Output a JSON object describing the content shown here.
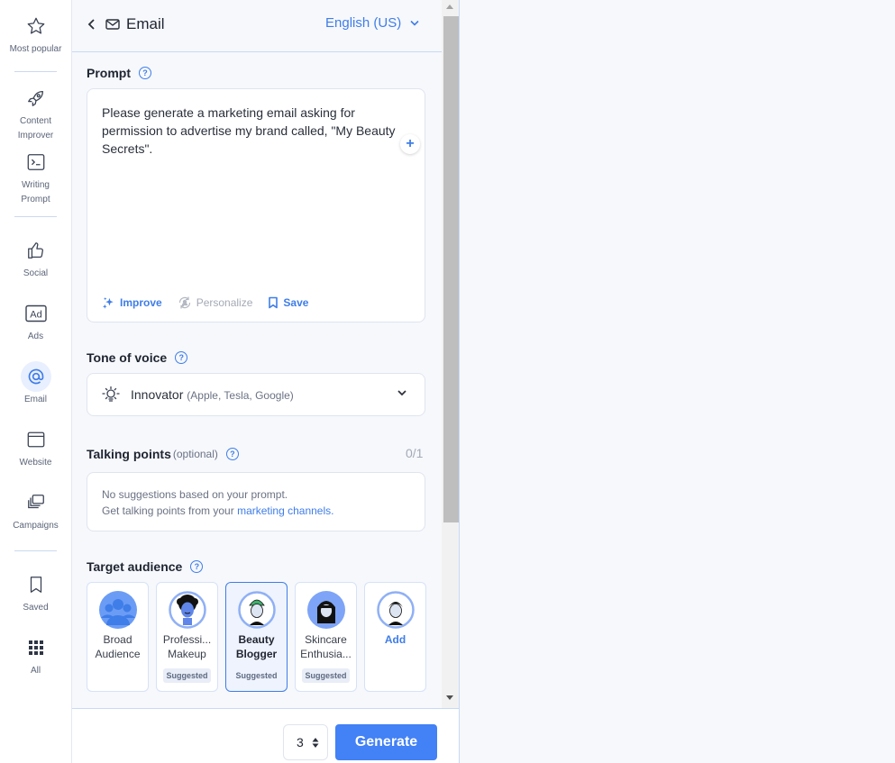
{
  "rail": {
    "items": [
      {
        "label": "Most popular",
        "icon": "star-icon"
      },
      {
        "label": "Content Improver",
        "icon": "rocket-icon"
      },
      {
        "label": "Writing Prompt",
        "icon": "terminal-icon"
      },
      {
        "label": "Social",
        "icon": "thumbs-up-icon"
      },
      {
        "label": "Ads",
        "icon": "ad-icon"
      },
      {
        "label": "Email",
        "icon": "at-icon",
        "active": true
      },
      {
        "label": "Website",
        "icon": "browser-window-icon"
      },
      {
        "label": "Campaigns",
        "icon": "stacked-windows-icon"
      },
      {
        "label": "Saved",
        "icon": "bookmark-icon"
      },
      {
        "label": "All",
        "icon": "grid-icon"
      }
    ]
  },
  "header": {
    "title": "Email",
    "language": "English (US)"
  },
  "prompt": {
    "label": "Prompt",
    "text": "Please generate a marketing email asking for permission to advertise my brand called, \"My Beauty Secrets\".",
    "add_symbol": "+",
    "actions": {
      "improve": "Improve",
      "personalize": "Personalize",
      "save": "Save"
    }
  },
  "tone": {
    "label": "Tone of voice",
    "value": "Innovator",
    "value_sub": "(Apple, Tesla, Google)"
  },
  "talking_points": {
    "label": "Talking points",
    "optional": "(optional)",
    "counter": "0/1",
    "empty_line1": "No suggestions based on your prompt.",
    "empty_line2_prefix": "Get talking points from your ",
    "empty_link": "marketing channels."
  },
  "audience": {
    "label": "Target audience",
    "items": [
      {
        "line1": "Broad",
        "line2": "Audience",
        "badge": ""
      },
      {
        "line1": "Professi...",
        "line2": "Makeup",
        "badge": "Suggested"
      },
      {
        "line1": "Beauty",
        "line2": "Blogger",
        "badge": "Suggested",
        "selected": true
      },
      {
        "line1": "Skincare",
        "line2": "Enthusia...",
        "badge": "Suggested"
      },
      {
        "line1": "Add",
        "line2": "",
        "badge": ""
      }
    ]
  },
  "footer": {
    "quantity": "3",
    "generate": "Generate"
  },
  "help_symbol": "?",
  "colors": {
    "accent": "#3f7de8",
    "button": "#4281f6",
    "background": "#f6f8fc"
  }
}
